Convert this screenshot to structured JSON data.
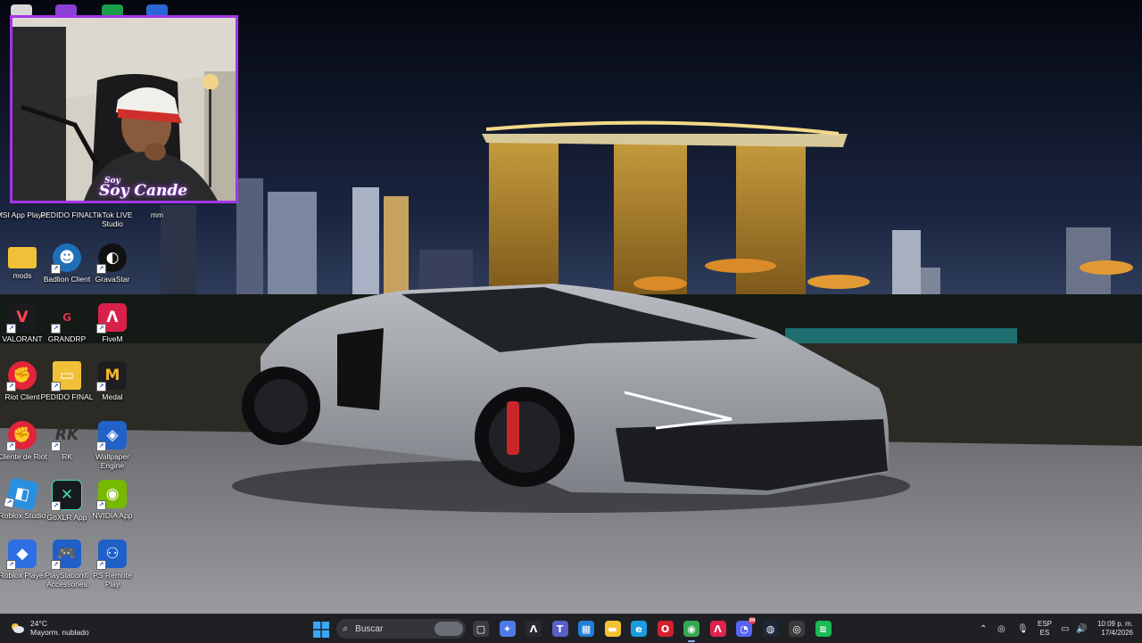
{
  "desktop": {
    "icons": [
      {
        "name": "msi-app-player",
        "label": "MSI App Player"
      },
      {
        "name": "pedido-final-1",
        "label": "PEDIDO FINAL"
      },
      {
        "name": "tiktok-live-studio",
        "label": "TikTok LIVE Studio"
      },
      {
        "name": "mm",
        "label": "mm"
      },
      {
        "name": "mods",
        "label": "mods"
      },
      {
        "name": "badlion-client",
        "label": "Badlion Client"
      },
      {
        "name": "gravastar",
        "label": "GravaStar"
      },
      {
        "name": "valorant",
        "label": "VALORANT"
      },
      {
        "name": "grandrp",
        "label": "GRANDRP"
      },
      {
        "name": "fivem",
        "label": "FiveM"
      },
      {
        "name": "riot-client",
        "label": "Riot Client"
      },
      {
        "name": "pedido-final-2",
        "label": "PEDIDO FINAL"
      },
      {
        "name": "medal",
        "label": "Medal"
      },
      {
        "name": "cliente-de-riot",
        "label": "Cliente de Riot"
      },
      {
        "name": "rk",
        "label": "RK"
      },
      {
        "name": "wallpaper-engine",
        "label": "Wallpaper Engine"
      },
      {
        "name": "roblox-studio",
        "label": "Roblox Studio"
      },
      {
        "name": "goxlr-app",
        "label": "GoXLR App"
      },
      {
        "name": "nvidia-app",
        "label": "NVIDIA App"
      },
      {
        "name": "roblox-player",
        "label": "Roblox Player"
      },
      {
        "name": "playstation-accessories",
        "label": "PlayStation® Accessories"
      },
      {
        "name": "ps-remote-play",
        "label": "PS Remote Play"
      }
    ]
  },
  "webcam": {
    "overlay_name": "Soy Cande",
    "overlay_top": "Soy"
  },
  "taskbar": {
    "weather": {
      "temp": "24°C",
      "desc": "Mayorm. nublado"
    },
    "search_placeholder": "Buscar",
    "apps": [
      {
        "name": "task-view",
        "glyph": "▢",
        "color": "#3a3b40"
      },
      {
        "name": "copilot",
        "glyph": "✦",
        "color": "#4e7be8"
      },
      {
        "name": "app-a",
        "glyph": "Λ",
        "color": "#2a2a2e"
      },
      {
        "name": "teams",
        "glyph": "T",
        "color": "#5b5fc7"
      },
      {
        "name": "store",
        "glyph": "▦",
        "color": "#1f7fd8"
      },
      {
        "name": "file-explorer",
        "glyph": "▬",
        "color": "#f3c234"
      },
      {
        "name": "edge",
        "glyph": "e",
        "color": "#1b9de2"
      },
      {
        "name": "opera",
        "glyph": "O",
        "color": "#d3202f"
      },
      {
        "name": "chrome",
        "glyph": "◉",
        "color": "#34a853"
      },
      {
        "name": "fivem",
        "glyph": "Λ",
        "color": "#e0234a"
      },
      {
        "name": "discord",
        "glyph": "◔",
        "color": "#5865f2",
        "badge": "30"
      },
      {
        "name": "steam",
        "glyph": "◍",
        "color": "#1b2838"
      },
      {
        "name": "obs",
        "glyph": "◎",
        "color": "#3a3a3a"
      },
      {
        "name": "spotify",
        "glyph": "≋",
        "color": "#1db954"
      }
    ],
    "lang": {
      "line1": "ESP",
      "line2": "ES"
    },
    "clock": {
      "time": "10:09 p. m.",
      "date": "17/4/2026"
    }
  }
}
